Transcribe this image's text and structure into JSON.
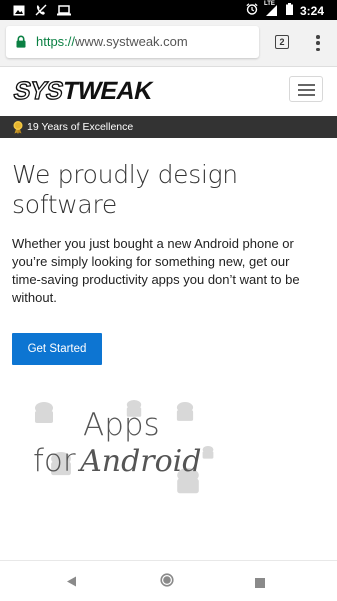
{
  "status_bar": {
    "time": "3:24",
    "network": "LTE",
    "icons": [
      "image-icon",
      "no-call-icon",
      "laptop-icon",
      "alarm-icon",
      "signal-icon",
      "battery-icon"
    ]
  },
  "browser": {
    "url_scheme": "https://",
    "url_host": "www.systweak.com",
    "tab_count": "2",
    "secure_color": "#0b8043"
  },
  "site": {
    "brand": "SYSTWEAK",
    "awards_text": "19 Years of Excellence",
    "hero_title": "We proudly design software",
    "hero_body": "Whether you just bought a new Android phone or you’re simply looking for something new, get our time-saving productivity apps you don’t want to be without.",
    "cta_label": "Get Started",
    "cta_color": "#0d75d2",
    "graphic_line1": "Apps",
    "graphic_for": "for",
    "graphic_android": "Android"
  },
  "nav": {
    "icons": [
      "back-icon",
      "home-icon",
      "recents-icon"
    ]
  }
}
